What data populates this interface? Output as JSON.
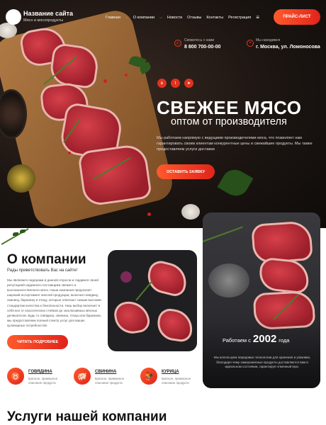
{
  "header": {
    "site_name": "Название сайта",
    "site_tagline": "Мясо и мясопродукты",
    "nav": [
      "Главная",
      "О компании",
      "Новости",
      "Отзывы",
      "Контакты",
      "Регистрация"
    ],
    "price_button": "ПРАЙС-ЛИСТ",
    "call_label": "Свяжитесь с нами",
    "phone": "8 800 700-00-00",
    "location_label": "Мы находимся",
    "address": "г. Москва, ул. Ломоносова"
  },
  "hero": {
    "title": "СВЕЖЕЕ МЯСО",
    "subtitle": "оптом от производителя",
    "text": "Мы работаем напрямую с ведущими производителями мяса, что позволяет нам гарантировать своим клиентам конкурентные цены и свежайшие продукты. Мы также предоставляем услуги доставки",
    "cta": "ОСТАВИТЬ ЗАЯВКУ",
    "social": [
      "vk-icon",
      "twitter-icon",
      "telegram-icon"
    ]
  },
  "about": {
    "title": "О компании",
    "subtitle": "Рады приветствовать Вас на сайте!",
    "text": "Мы являемся лидерами в данной отрасли и гордимся своей репутацией надежного поставщика свежего и высококачественного мяса. Наша компания предлагает широкий ассортимент мясной продукции, включая говядину, свинину, баранину и птицу, которые отвечают самым высоким стандартам качества и безопасности. Наш выбор включает в себя все от классических стейков до эксклюзивных мясных деликатесов. Будь то говядина, свинина, птица или баранина, мы предоставляем полный спектр услуг для ваших кулинарных потребностей.",
    "more_button": "ЧИТАТЬ ПОДРОБНЕЕ",
    "since_prefix": "Работаем с",
    "since_year": "2002",
    "since_suffix": "года",
    "since_text": "Мы используем передовые технологии для хранения и упаковки, благодаря чему замороженные продукты доставляются вам в идеальном состоянии, гарантируя отменный вкус.",
    "categories": [
      {
        "name": "ГОВЯДИНА",
        "desc": "Краткое, примерное описание продукта",
        "icon": "cow-icon"
      },
      {
        "name": "СВИНИНА",
        "desc": "Краткое, примерное описание продукта",
        "icon": "pig-icon"
      },
      {
        "name": "КУРИЦА",
        "desc": "Краткое, примерное описание продукта",
        "icon": "chicken-icon"
      }
    ]
  },
  "services": {
    "title": "Услуги нашей компании"
  },
  "colors": {
    "accent": "#e0241b",
    "accent_light": "#ff5a2c",
    "dark": "#1c1512"
  }
}
